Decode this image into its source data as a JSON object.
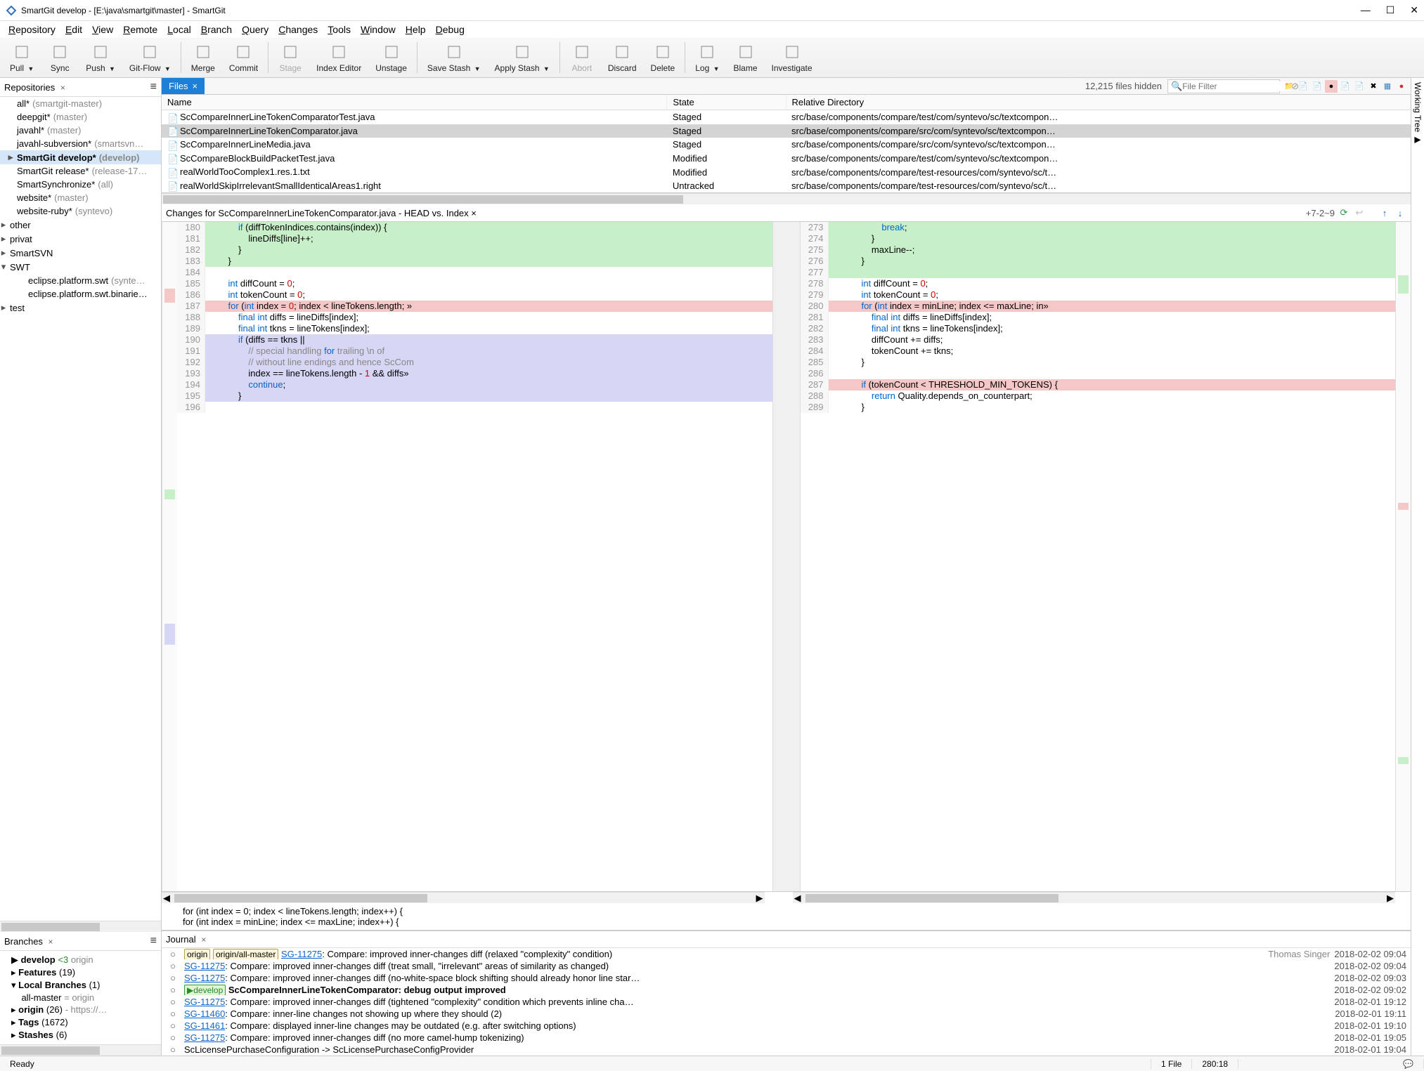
{
  "window": {
    "title": "SmartGit develop - [E:\\java\\smartgit\\master] - SmartGit"
  },
  "menu": [
    "Repository",
    "Edit",
    "View",
    "Remote",
    "Local",
    "Branch",
    "Query",
    "Changes",
    "Tools",
    "Window",
    "Help",
    "Debug"
  ],
  "toolbar": [
    {
      "label": "Pull",
      "caret": true
    },
    {
      "label": "Sync"
    },
    {
      "label": "Push",
      "caret": true
    },
    {
      "label": "Git-Flow",
      "caret": true
    },
    {
      "sep": true
    },
    {
      "label": "Merge"
    },
    {
      "label": "Commit"
    },
    {
      "sep": true
    },
    {
      "label": "Stage",
      "disabled": true
    },
    {
      "label": "Index Editor"
    },
    {
      "label": "Unstage"
    },
    {
      "sep": true
    },
    {
      "label": "Save Stash",
      "caret": true
    },
    {
      "label": "Apply Stash",
      "caret": true
    },
    {
      "sep": true
    },
    {
      "label": "Abort",
      "disabled": true
    },
    {
      "label": "Discard"
    },
    {
      "label": "Delete"
    },
    {
      "sep": true
    },
    {
      "label": "Log",
      "caret": true
    },
    {
      "label": "Blame"
    },
    {
      "label": "Investigate"
    }
  ],
  "repos": {
    "title": "Repositories",
    "items": [
      {
        "name": "all*",
        "extra": "(smartgit-master)"
      },
      {
        "name": "deepgit*",
        "extra": "(master)"
      },
      {
        "name": "javahl*",
        "extra": "(master)"
      },
      {
        "name": "javahl-subversion*",
        "extra": "(smartsvn…"
      },
      {
        "name": "SmartGit develop*",
        "extra": "(develop)",
        "sel": true,
        "tw": "▸"
      },
      {
        "name": "SmartGit release*",
        "extra": "(release-17…"
      },
      {
        "name": "SmartSynchronize*",
        "extra": "(all)"
      },
      {
        "name": "website*",
        "extra": "(master)"
      },
      {
        "name": "website-ruby*",
        "extra": "(syntevo)"
      }
    ],
    "groups": [
      {
        "name": "other",
        "tw": "▸"
      },
      {
        "name": "privat",
        "tw": "▸"
      },
      {
        "name": "SmartSVN",
        "tw": "▸"
      },
      {
        "name": "SWT",
        "tw": "▾",
        "children": [
          {
            "name": "eclipse.platform.swt",
            "extra": "(synte…"
          },
          {
            "name": "eclipse.platform.swt.binarie…"
          }
        ]
      },
      {
        "name": "test",
        "tw": "▸"
      }
    ]
  },
  "branches": {
    "title": "Branches",
    "items": [
      {
        "html": "▶ <b>develop</b> <span class='green'>&lt;3</span> <span class='grey'>origin</span>"
      },
      {
        "html": "▸ <b>Features</b> (19)"
      },
      {
        "html": "▾ <b>Local Branches</b> (1)"
      },
      {
        "html": "&nbsp;&nbsp;&nbsp;&nbsp;all-master <span class='grey'>= origin</span>"
      },
      {
        "html": "▸ <b>origin</b> (26) <span class='grey'>- https://…</span>"
      },
      {
        "html": "▸ <b>Tags</b> (1672)"
      },
      {
        "html": "▸ <b>Stashes</b> (6)"
      }
    ]
  },
  "files": {
    "tab": "Files",
    "hidden": "12,215 files hidden",
    "filter_placeholder": "File Filter",
    "cols": [
      "Name",
      "State",
      "Relative Directory"
    ],
    "rows": [
      {
        "name": "ScCompareInnerLineTokenComparatorTest.java",
        "state": "Staged",
        "dir": "src/base/components/compare/test/com/syntevo/sc/textcompon…"
      },
      {
        "name": "ScCompareInnerLineTokenComparator.java",
        "state": "Staged",
        "dir": "src/base/components/compare/src/com/syntevo/sc/textcompon…",
        "sel": true
      },
      {
        "name": "ScCompareInnerLineMedia.java",
        "state": "Staged",
        "dir": "src/base/components/compare/src/com/syntevo/sc/textcompon…"
      },
      {
        "name": "ScCompareBlockBuildPacketTest.java",
        "state": "Modified",
        "dir": "src/base/components/compare/test/com/syntevo/sc/textcompon…"
      },
      {
        "name": "realWorldTooComplex1.res.1.txt",
        "state": "Modified",
        "dir": "src/base/components/compare/test-resources/com/syntevo/sc/t…"
      },
      {
        "name": "realWorldSkipIrrelevantSmallIdenticalAreas1.right",
        "state": "Untracked",
        "dir": "src/base/components/compare/test-resources/com/syntevo/sc/t…"
      }
    ]
  },
  "changes": {
    "title": "Changes for ScCompareInnerLineTokenComparator.java - HEAD vs. Index",
    "stats": "+7-2~9",
    "left": [
      {
        "n": 180,
        "t": "            if (diffTokenIndices.contains(index)) {",
        "cls": "added"
      },
      {
        "n": 181,
        "t": "                lineDiffs[line]++;",
        "cls": "added"
      },
      {
        "n": 182,
        "t": "            }",
        "cls": "added"
      },
      {
        "n": 183,
        "t": "        }",
        "cls": "added"
      },
      {
        "n": 184,
        "t": ""
      },
      {
        "n": 185,
        "t": "        int diffCount = 0;"
      },
      {
        "n": 186,
        "t": "        int tokenCount = 0;"
      },
      {
        "n": 187,
        "t": "        for (int index = 0; index < lineTokens.length; »",
        "cls": "removed"
      },
      {
        "n": 188,
        "t": "            final int diffs = lineDiffs[index];"
      },
      {
        "n": 189,
        "t": "            final int tkns = lineTokens[index];"
      },
      {
        "n": 190,
        "t": "            if (diffs == tkns ||",
        "cls": "mod"
      },
      {
        "n": 191,
        "t": "                // special handling for trailing \\n of",
        "cls": "mod"
      },
      {
        "n": 192,
        "t": "                // without line endings and hence ScCom",
        "cls": "mod"
      },
      {
        "n": 193,
        "t": "                index == lineTokens.length - 1 && diffs»",
        "cls": "mod"
      },
      {
        "n": 194,
        "t": "                continue;",
        "cls": "mod"
      },
      {
        "n": 195,
        "t": "            }",
        "cls": "mod"
      },
      {
        "n": 196,
        "t": ""
      }
    ],
    "right": [
      {
        "n": 273,
        "t": "                    break;",
        "cls": "added"
      },
      {
        "n": 274,
        "t": "                }",
        "cls": "added"
      },
      {
        "n": 275,
        "t": "                maxLine--;",
        "cls": "added"
      },
      {
        "n": 276,
        "t": "            }",
        "cls": "added"
      },
      {
        "n": 277,
        "t": "",
        "cls": "added"
      },
      {
        "n": 278,
        "t": "            int diffCount = 0;"
      },
      {
        "n": 279,
        "t": "            int tokenCount = 0;"
      },
      {
        "n": 280,
        "t": "            for (int index = minLine; index <= maxLine; in»",
        "cls": "removed"
      },
      {
        "n": 281,
        "t": "                final int diffs = lineDiffs[index];"
      },
      {
        "n": 282,
        "t": "                final int tkns = lineTokens[index];"
      },
      {
        "n": 283,
        "t": "                diffCount += diffs;",
        "cls": ""
      },
      {
        "n": 284,
        "t": "                tokenCount += tkns;",
        "cls": ""
      },
      {
        "n": 285,
        "t": "            }",
        "cls": ""
      },
      {
        "n": 286,
        "t": ""
      },
      {
        "n": 287,
        "t": "            if (tokenCount < THRESHOLD_MIN_TOKENS) {",
        "cls": "removed"
      },
      {
        "n": 288,
        "t": "                return Quality.depends_on_counterpart;"
      },
      {
        "n": 289,
        "t": "            }"
      }
    ],
    "foot1": "    for (int index = 0; index < lineTokens.length; index++) {",
    "foot2": "    for (int index = minLine; index <= maxLine; index++) {"
  },
  "journal": {
    "title": "Journal",
    "rows": [
      {
        "refs": [
          "origin",
          "origin/all-master"
        ],
        "link": "SG-11275",
        "msg": ": Compare: improved inner-changes diff (relaxed \"complexity\" condition)",
        "author": "Thomas Singer",
        "time": "2018-02-02 09:04"
      },
      {
        "link": "SG-11275",
        "msg": ": Compare: improved inner-changes diff (treat small, \"irrelevant\" areas of similarity as changed)",
        "time": "2018-02-02 09:04"
      },
      {
        "link": "SG-11275",
        "msg": ": Compare: improved inner-changes diff (no-white-space block shifting should already honor line star…",
        "time": "2018-02-02 09:03"
      },
      {
        "devref": "develop",
        "boldmsg": "ScCompareInnerLineTokenComparator: debug output improved",
        "time": "2018-02-02 09:02"
      },
      {
        "link": "SG-11275",
        "msg": ": Compare: improved inner-changes diff (tightened \"complexity\" condition which prevents inline cha…",
        "time": "2018-02-01 19:12"
      },
      {
        "link": "SG-11460",
        "msg": ": Compare: inner-line changes not showing up where they should (2)",
        "time": "2018-02-01 19:11"
      },
      {
        "link": "SG-11461",
        "msg": ": Compare: displayed inner-line changes may be outdated (e.g. after switching options)",
        "time": "2018-02-01 19:10"
      },
      {
        "link": "SG-11275",
        "msg": ": Compare: improved inner-changes diff (no more camel-hump tokenizing)",
        "time": "2018-02-01 19:05"
      },
      {
        "plain": "ScLicensePurchaseConfiguration -> ScLicensePurchaseConfigProvider",
        "time": "2018-02-01 19:04"
      }
    ]
  },
  "status": {
    "ready": "Ready",
    "files": "1 File",
    "pos": "280:18"
  },
  "side_label": "Working Tree ▶"
}
